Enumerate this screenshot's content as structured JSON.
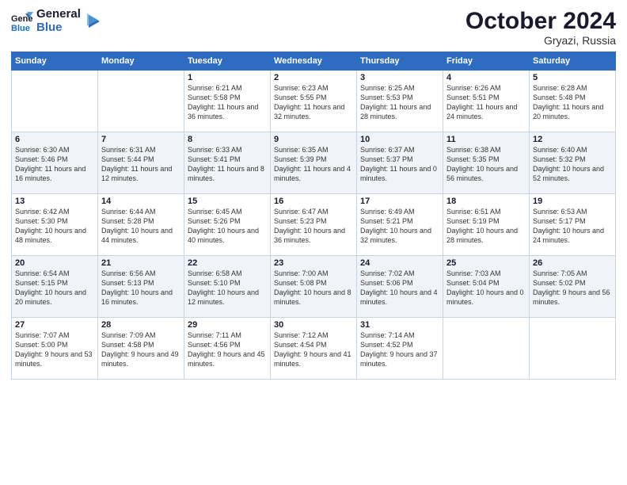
{
  "header": {
    "logo_line1": "General",
    "logo_line2": "Blue",
    "month": "October 2024",
    "location": "Gryazi, Russia"
  },
  "weekdays": [
    "Sunday",
    "Monday",
    "Tuesday",
    "Wednesday",
    "Thursday",
    "Friday",
    "Saturday"
  ],
  "weeks": [
    [
      {
        "day": "",
        "detail": ""
      },
      {
        "day": "",
        "detail": ""
      },
      {
        "day": "1",
        "detail": "Sunrise: 6:21 AM\nSunset: 5:58 PM\nDaylight: 11 hours and 36 minutes."
      },
      {
        "day": "2",
        "detail": "Sunrise: 6:23 AM\nSunset: 5:55 PM\nDaylight: 11 hours and 32 minutes."
      },
      {
        "day": "3",
        "detail": "Sunrise: 6:25 AM\nSunset: 5:53 PM\nDaylight: 11 hours and 28 minutes."
      },
      {
        "day": "4",
        "detail": "Sunrise: 6:26 AM\nSunset: 5:51 PM\nDaylight: 11 hours and 24 minutes."
      },
      {
        "day": "5",
        "detail": "Sunrise: 6:28 AM\nSunset: 5:48 PM\nDaylight: 11 hours and 20 minutes."
      }
    ],
    [
      {
        "day": "6",
        "detail": "Sunrise: 6:30 AM\nSunset: 5:46 PM\nDaylight: 11 hours and 16 minutes."
      },
      {
        "day": "7",
        "detail": "Sunrise: 6:31 AM\nSunset: 5:44 PM\nDaylight: 11 hours and 12 minutes."
      },
      {
        "day": "8",
        "detail": "Sunrise: 6:33 AM\nSunset: 5:41 PM\nDaylight: 11 hours and 8 minutes."
      },
      {
        "day": "9",
        "detail": "Sunrise: 6:35 AM\nSunset: 5:39 PM\nDaylight: 11 hours and 4 minutes."
      },
      {
        "day": "10",
        "detail": "Sunrise: 6:37 AM\nSunset: 5:37 PM\nDaylight: 11 hours and 0 minutes."
      },
      {
        "day": "11",
        "detail": "Sunrise: 6:38 AM\nSunset: 5:35 PM\nDaylight: 10 hours and 56 minutes."
      },
      {
        "day": "12",
        "detail": "Sunrise: 6:40 AM\nSunset: 5:32 PM\nDaylight: 10 hours and 52 minutes."
      }
    ],
    [
      {
        "day": "13",
        "detail": "Sunrise: 6:42 AM\nSunset: 5:30 PM\nDaylight: 10 hours and 48 minutes."
      },
      {
        "day": "14",
        "detail": "Sunrise: 6:44 AM\nSunset: 5:28 PM\nDaylight: 10 hours and 44 minutes."
      },
      {
        "day": "15",
        "detail": "Sunrise: 6:45 AM\nSunset: 5:26 PM\nDaylight: 10 hours and 40 minutes."
      },
      {
        "day": "16",
        "detail": "Sunrise: 6:47 AM\nSunset: 5:23 PM\nDaylight: 10 hours and 36 minutes."
      },
      {
        "day": "17",
        "detail": "Sunrise: 6:49 AM\nSunset: 5:21 PM\nDaylight: 10 hours and 32 minutes."
      },
      {
        "day": "18",
        "detail": "Sunrise: 6:51 AM\nSunset: 5:19 PM\nDaylight: 10 hours and 28 minutes."
      },
      {
        "day": "19",
        "detail": "Sunrise: 6:53 AM\nSunset: 5:17 PM\nDaylight: 10 hours and 24 minutes."
      }
    ],
    [
      {
        "day": "20",
        "detail": "Sunrise: 6:54 AM\nSunset: 5:15 PM\nDaylight: 10 hours and 20 minutes."
      },
      {
        "day": "21",
        "detail": "Sunrise: 6:56 AM\nSunset: 5:13 PM\nDaylight: 10 hours and 16 minutes."
      },
      {
        "day": "22",
        "detail": "Sunrise: 6:58 AM\nSunset: 5:10 PM\nDaylight: 10 hours and 12 minutes."
      },
      {
        "day": "23",
        "detail": "Sunrise: 7:00 AM\nSunset: 5:08 PM\nDaylight: 10 hours and 8 minutes."
      },
      {
        "day": "24",
        "detail": "Sunrise: 7:02 AM\nSunset: 5:06 PM\nDaylight: 10 hours and 4 minutes."
      },
      {
        "day": "25",
        "detail": "Sunrise: 7:03 AM\nSunset: 5:04 PM\nDaylight: 10 hours and 0 minutes."
      },
      {
        "day": "26",
        "detail": "Sunrise: 7:05 AM\nSunset: 5:02 PM\nDaylight: 9 hours and 56 minutes."
      }
    ],
    [
      {
        "day": "27",
        "detail": "Sunrise: 7:07 AM\nSunset: 5:00 PM\nDaylight: 9 hours and 53 minutes."
      },
      {
        "day": "28",
        "detail": "Sunrise: 7:09 AM\nSunset: 4:58 PM\nDaylight: 9 hours and 49 minutes."
      },
      {
        "day": "29",
        "detail": "Sunrise: 7:11 AM\nSunset: 4:56 PM\nDaylight: 9 hours and 45 minutes."
      },
      {
        "day": "30",
        "detail": "Sunrise: 7:12 AM\nSunset: 4:54 PM\nDaylight: 9 hours and 41 minutes."
      },
      {
        "day": "31",
        "detail": "Sunrise: 7:14 AM\nSunset: 4:52 PM\nDaylight: 9 hours and 37 minutes."
      },
      {
        "day": "",
        "detail": ""
      },
      {
        "day": "",
        "detail": ""
      }
    ]
  ]
}
